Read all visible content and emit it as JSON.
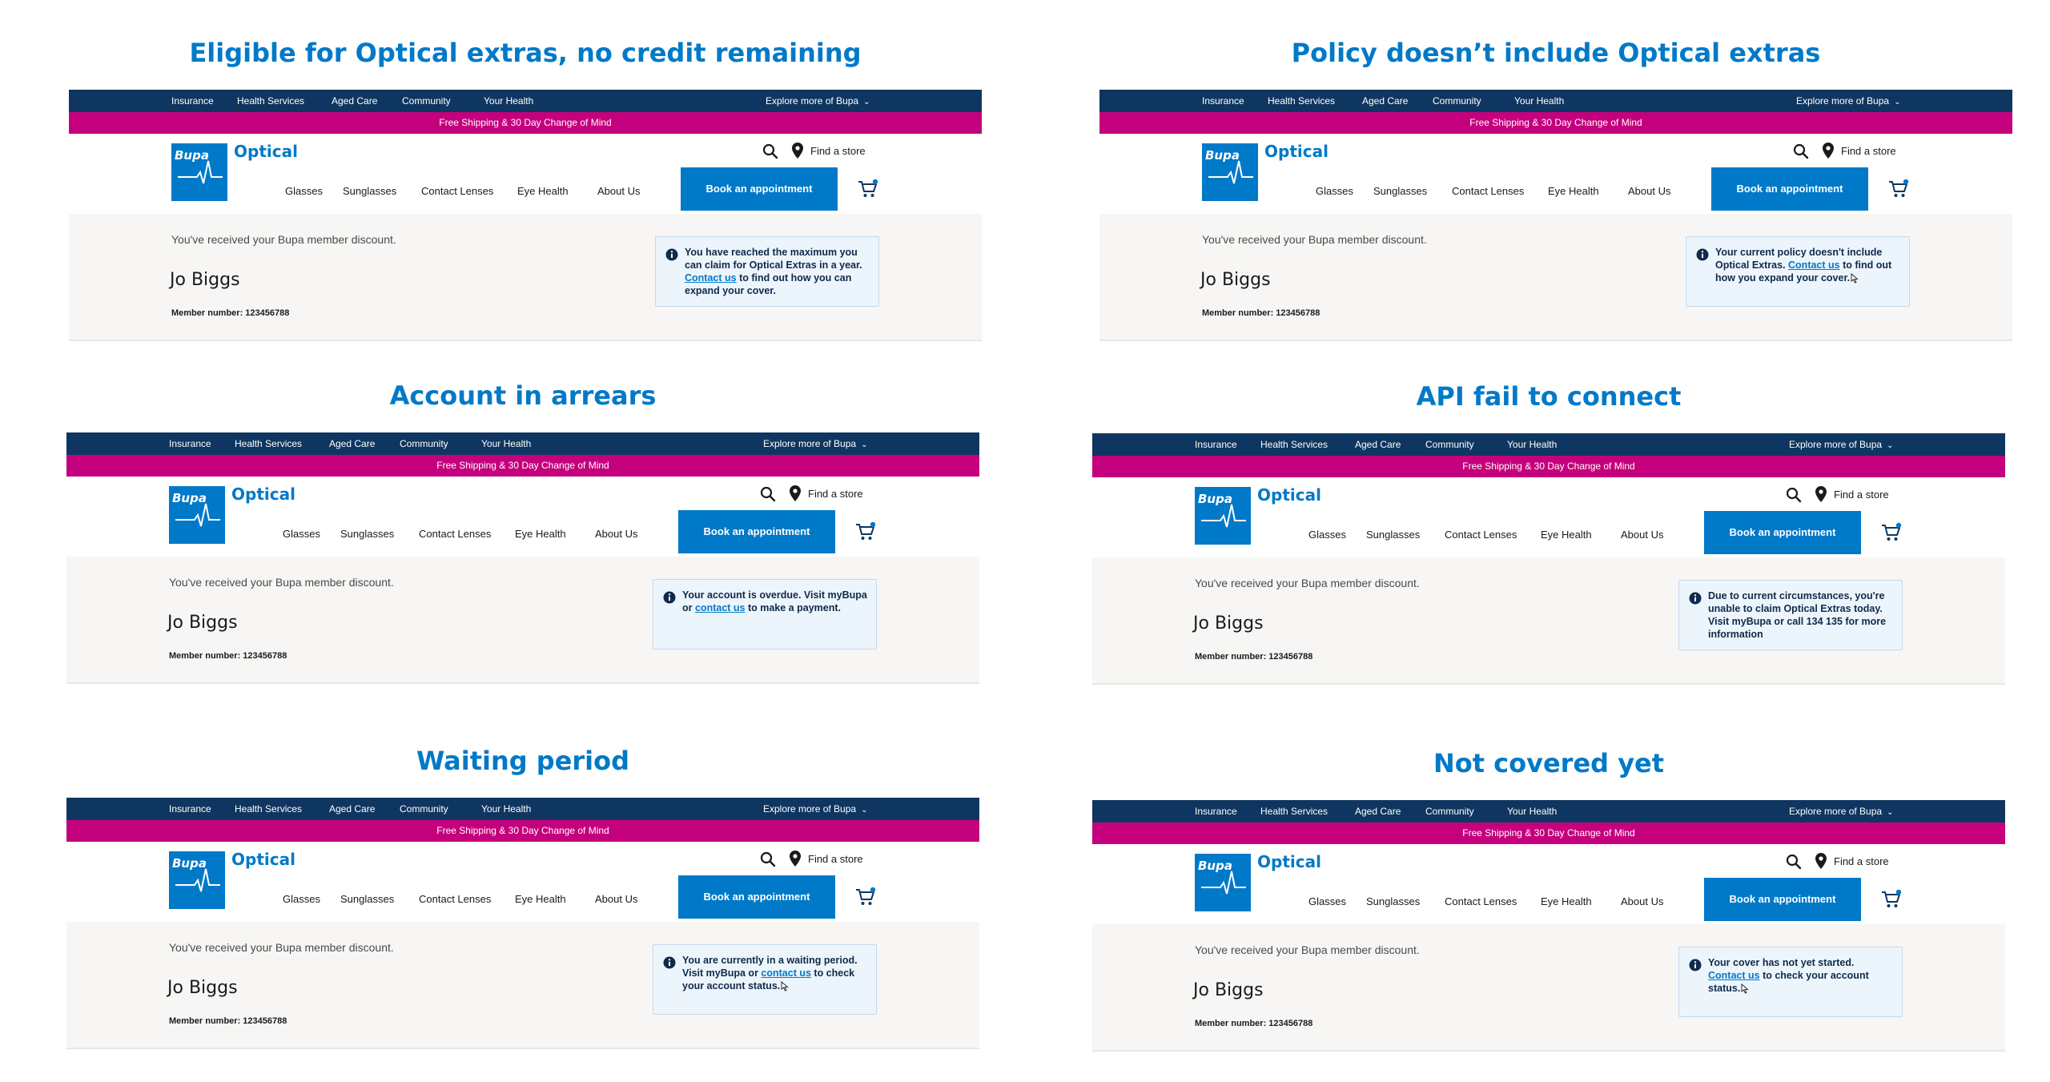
{
  "header": {
    "topnav": [
      "Insurance",
      "Health Services",
      "Aged Care",
      "Community",
      "Your Health"
    ],
    "explore": "Explore more of Bupa",
    "promo": "Free Shipping & 30 Day Change of Mind",
    "logo_word": "Bupa",
    "brand": "Optical",
    "find_store": "Find a store",
    "nav": [
      "Glasses",
      "Sunglasses",
      "Contact Lenses",
      "Eye Health",
      "About Us"
    ],
    "book": "Book an appointment",
    "icons": [
      "chevron-down-icon",
      "search-icon",
      "location-pin-icon",
      "cart-icon",
      "info-icon",
      "pointer-cursor-icon"
    ],
    "colors": {
      "navy": "#0f3660",
      "magenta": "#c4007c",
      "blue": "#0079c8",
      "panel": "#f7f6f4",
      "alert_bg": "#edf5fc"
    }
  },
  "member": {
    "discount": "You've received your Bupa member discount.",
    "name": "Jo Biggs",
    "number": "Member number: 123456788"
  },
  "scenarios": [
    {
      "title": "Eligible for Optical extras, no credit remaining",
      "alert": {
        "pre": "You have reached the maximum you can claim for Optical Extras in a year. ",
        "link": "Contact us",
        "post": " to find out how you can expand your cover."
      }
    },
    {
      "title": "Policy doesn’t include Optical extras",
      "alert": {
        "pre": "Your current policy doesn't include Optical Extras. ",
        "link": "Contact us",
        "post": " to find out how you expand your cover."
      }
    },
    {
      "title": "Account in arrears",
      "alert": {
        "pre": "Your account is overdue. Visit myBupa or ",
        "link": "contact us",
        "post": " to make a payment."
      }
    },
    {
      "title": "API fail to connect",
      "alert": {
        "pre": "Due to current circumstances, you're unable to claim Optical Extras today. Visit myBupa or call 134 135 for more information",
        "link": "",
        "post": ""
      }
    },
    {
      "title": "Waiting period",
      "alert": {
        "pre": "You are currently in a waiting period. Visit myBupa or ",
        "link": "contact us",
        "post": " to check your account status."
      }
    },
    {
      "title": "Not covered yet",
      "alert": {
        "pre": "Your cover has not yet started. ",
        "link": "Contact us",
        "post": " to check your account status."
      }
    }
  ]
}
